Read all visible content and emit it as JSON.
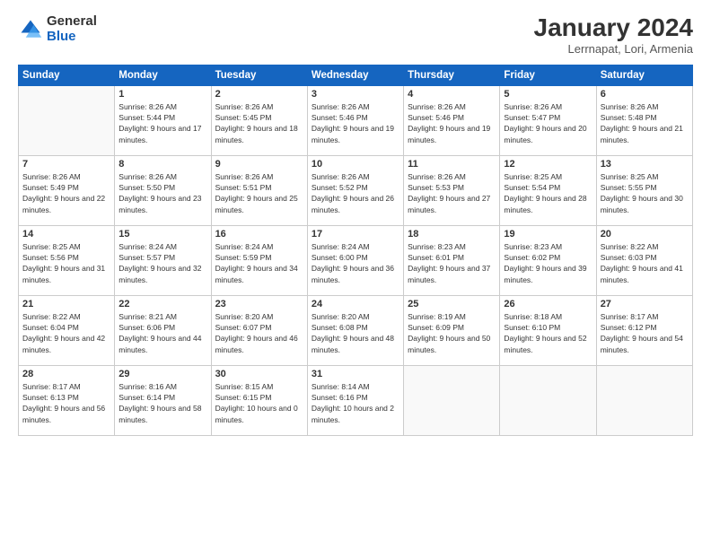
{
  "logo": {
    "general": "General",
    "blue": "Blue"
  },
  "title": "January 2024",
  "subtitle": "Lerrnapat, Lori, Armenia",
  "headers": [
    "Sunday",
    "Monday",
    "Tuesday",
    "Wednesday",
    "Thursday",
    "Friday",
    "Saturday"
  ],
  "weeks": [
    [
      {
        "day": "",
        "sunrise": "",
        "sunset": "",
        "daylight": ""
      },
      {
        "day": "1",
        "sunrise": "Sunrise: 8:26 AM",
        "sunset": "Sunset: 5:44 PM",
        "daylight": "Daylight: 9 hours and 17 minutes."
      },
      {
        "day": "2",
        "sunrise": "Sunrise: 8:26 AM",
        "sunset": "Sunset: 5:45 PM",
        "daylight": "Daylight: 9 hours and 18 minutes."
      },
      {
        "day": "3",
        "sunrise": "Sunrise: 8:26 AM",
        "sunset": "Sunset: 5:46 PM",
        "daylight": "Daylight: 9 hours and 19 minutes."
      },
      {
        "day": "4",
        "sunrise": "Sunrise: 8:26 AM",
        "sunset": "Sunset: 5:46 PM",
        "daylight": "Daylight: 9 hours and 19 minutes."
      },
      {
        "day": "5",
        "sunrise": "Sunrise: 8:26 AM",
        "sunset": "Sunset: 5:47 PM",
        "daylight": "Daylight: 9 hours and 20 minutes."
      },
      {
        "day": "6",
        "sunrise": "Sunrise: 8:26 AM",
        "sunset": "Sunset: 5:48 PM",
        "daylight": "Daylight: 9 hours and 21 minutes."
      }
    ],
    [
      {
        "day": "7",
        "sunrise": "Sunrise: 8:26 AM",
        "sunset": "Sunset: 5:49 PM",
        "daylight": "Daylight: 9 hours and 22 minutes."
      },
      {
        "day": "8",
        "sunrise": "Sunrise: 8:26 AM",
        "sunset": "Sunset: 5:50 PM",
        "daylight": "Daylight: 9 hours and 23 minutes."
      },
      {
        "day": "9",
        "sunrise": "Sunrise: 8:26 AM",
        "sunset": "Sunset: 5:51 PM",
        "daylight": "Daylight: 9 hours and 25 minutes."
      },
      {
        "day": "10",
        "sunrise": "Sunrise: 8:26 AM",
        "sunset": "Sunset: 5:52 PM",
        "daylight": "Daylight: 9 hours and 26 minutes."
      },
      {
        "day": "11",
        "sunrise": "Sunrise: 8:26 AM",
        "sunset": "Sunset: 5:53 PM",
        "daylight": "Daylight: 9 hours and 27 minutes."
      },
      {
        "day": "12",
        "sunrise": "Sunrise: 8:25 AM",
        "sunset": "Sunset: 5:54 PM",
        "daylight": "Daylight: 9 hours and 28 minutes."
      },
      {
        "day": "13",
        "sunrise": "Sunrise: 8:25 AM",
        "sunset": "Sunset: 5:55 PM",
        "daylight": "Daylight: 9 hours and 30 minutes."
      }
    ],
    [
      {
        "day": "14",
        "sunrise": "Sunrise: 8:25 AM",
        "sunset": "Sunset: 5:56 PM",
        "daylight": "Daylight: 9 hours and 31 minutes."
      },
      {
        "day": "15",
        "sunrise": "Sunrise: 8:24 AM",
        "sunset": "Sunset: 5:57 PM",
        "daylight": "Daylight: 9 hours and 32 minutes."
      },
      {
        "day": "16",
        "sunrise": "Sunrise: 8:24 AM",
        "sunset": "Sunset: 5:59 PM",
        "daylight": "Daylight: 9 hours and 34 minutes."
      },
      {
        "day": "17",
        "sunrise": "Sunrise: 8:24 AM",
        "sunset": "Sunset: 6:00 PM",
        "daylight": "Daylight: 9 hours and 36 minutes."
      },
      {
        "day": "18",
        "sunrise": "Sunrise: 8:23 AM",
        "sunset": "Sunset: 6:01 PM",
        "daylight": "Daylight: 9 hours and 37 minutes."
      },
      {
        "day": "19",
        "sunrise": "Sunrise: 8:23 AM",
        "sunset": "Sunset: 6:02 PM",
        "daylight": "Daylight: 9 hours and 39 minutes."
      },
      {
        "day": "20",
        "sunrise": "Sunrise: 8:22 AM",
        "sunset": "Sunset: 6:03 PM",
        "daylight": "Daylight: 9 hours and 41 minutes."
      }
    ],
    [
      {
        "day": "21",
        "sunrise": "Sunrise: 8:22 AM",
        "sunset": "Sunset: 6:04 PM",
        "daylight": "Daylight: 9 hours and 42 minutes."
      },
      {
        "day": "22",
        "sunrise": "Sunrise: 8:21 AM",
        "sunset": "Sunset: 6:06 PM",
        "daylight": "Daylight: 9 hours and 44 minutes."
      },
      {
        "day": "23",
        "sunrise": "Sunrise: 8:20 AM",
        "sunset": "Sunset: 6:07 PM",
        "daylight": "Daylight: 9 hours and 46 minutes."
      },
      {
        "day": "24",
        "sunrise": "Sunrise: 8:20 AM",
        "sunset": "Sunset: 6:08 PM",
        "daylight": "Daylight: 9 hours and 48 minutes."
      },
      {
        "day": "25",
        "sunrise": "Sunrise: 8:19 AM",
        "sunset": "Sunset: 6:09 PM",
        "daylight": "Daylight: 9 hours and 50 minutes."
      },
      {
        "day": "26",
        "sunrise": "Sunrise: 8:18 AM",
        "sunset": "Sunset: 6:10 PM",
        "daylight": "Daylight: 9 hours and 52 minutes."
      },
      {
        "day": "27",
        "sunrise": "Sunrise: 8:17 AM",
        "sunset": "Sunset: 6:12 PM",
        "daylight": "Daylight: 9 hours and 54 minutes."
      }
    ],
    [
      {
        "day": "28",
        "sunrise": "Sunrise: 8:17 AM",
        "sunset": "Sunset: 6:13 PM",
        "daylight": "Daylight: 9 hours and 56 minutes."
      },
      {
        "day": "29",
        "sunrise": "Sunrise: 8:16 AM",
        "sunset": "Sunset: 6:14 PM",
        "daylight": "Daylight: 9 hours and 58 minutes."
      },
      {
        "day": "30",
        "sunrise": "Sunrise: 8:15 AM",
        "sunset": "Sunset: 6:15 PM",
        "daylight": "Daylight: 10 hours and 0 minutes."
      },
      {
        "day": "31",
        "sunrise": "Sunrise: 8:14 AM",
        "sunset": "Sunset: 6:16 PM",
        "daylight": "Daylight: 10 hours and 2 minutes."
      },
      {
        "day": "",
        "sunrise": "",
        "sunset": "",
        "daylight": ""
      },
      {
        "day": "",
        "sunrise": "",
        "sunset": "",
        "daylight": ""
      },
      {
        "day": "",
        "sunrise": "",
        "sunset": "",
        "daylight": ""
      }
    ]
  ]
}
